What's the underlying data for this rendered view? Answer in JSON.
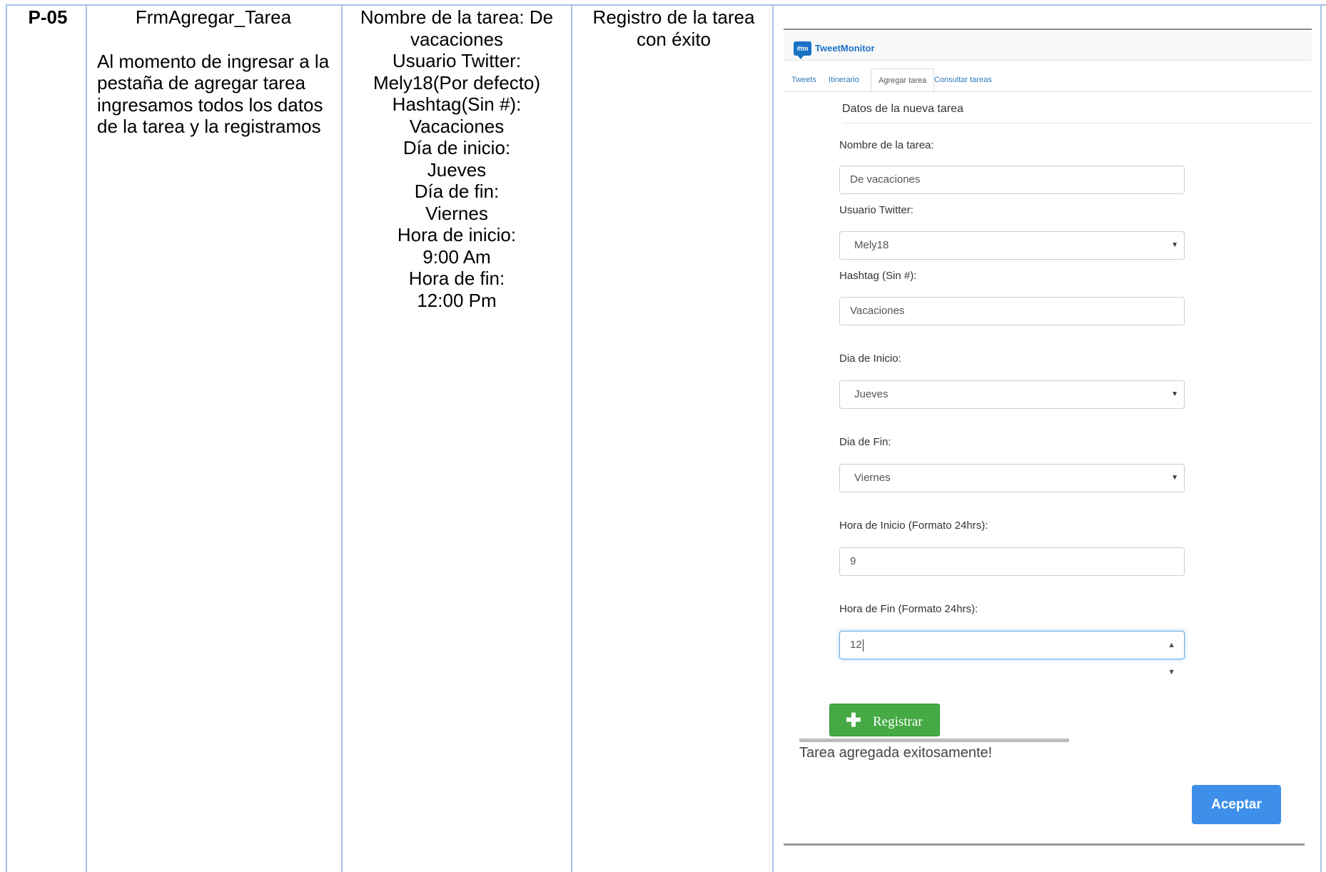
{
  "test_case": {
    "id": "P-05",
    "form_name": "FrmAgregar_Tarea",
    "description": "Al momento de ingresar a la pestaña de agregar tarea ingresamos todos los datos de la tarea y la registramos",
    "input_lines": [
      "Nombre de la tarea: De",
      "vacaciones",
      "Usuario Twitter:",
      "Mely18(Por defecto)",
      "Hashtag(Sin #):",
      "Vacaciones",
      "Día de inicio:",
      "Jueves",
      "Día de fin:",
      "Viernes",
      "Hora de inicio:",
      "9:00 Am",
      "Hora de fin:",
      "12:00 Pm"
    ],
    "expected_lines": [
      "Registro de la tarea",
      "con éxito"
    ]
  },
  "app": {
    "logo_text": "#tm",
    "brand": "TweetMonitor",
    "tabs": [
      {
        "label": "Tweets",
        "active": false
      },
      {
        "label": "Itinerario",
        "active": false
      },
      {
        "label": "Agregar tarea",
        "active": true
      },
      {
        "label": "Consultar tareas",
        "active": false
      }
    ],
    "section_title": "Datos de la nueva tarea",
    "form": {
      "task_name": {
        "label": "Nombre de la tarea:",
        "value": "De vacaciones"
      },
      "twitter_user": {
        "label": "Usuario Twitter:",
        "value": "Mely18"
      },
      "hashtag": {
        "label": "Hashtag (Sin #):",
        "value": "Vacaciones"
      },
      "start_day": {
        "label": "Dia de Inicio:",
        "value": "Jueves"
      },
      "end_day": {
        "label": "Dia de Fin:",
        "value": "Viernes"
      },
      "start_hour": {
        "label": "Hora de Inicio (Formato 24hrs):",
        "value": "9"
      },
      "end_hour": {
        "label": "Hora de Fin (Formato 24hrs):",
        "value": "12"
      }
    },
    "register_button": "Registrar",
    "success_message": "Tarea agregada exitosamente!",
    "accept_button": "Aceptar",
    "colors": {
      "brand_blue": "#1b73c5",
      "success_green": "#45a944",
      "accept_blue": "#3d8fea",
      "link_blue": "#337ab7"
    },
    "icons": [
      "chat-bubble-logo-icon",
      "caret-down-icon",
      "spinner-icon",
      "plus-icon"
    ]
  }
}
